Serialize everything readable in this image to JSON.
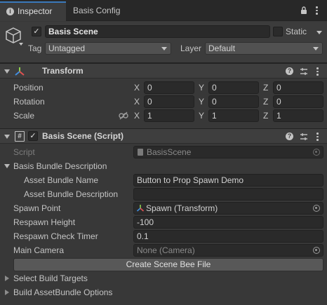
{
  "tabs": [
    {
      "label": "Inspector",
      "active": true,
      "icon": "info-icon"
    },
    {
      "label": "Basis Config",
      "active": false
    }
  ],
  "gameobject": {
    "active": true,
    "name": "Basis Scene",
    "static_label": "Static",
    "tag_label": "Tag",
    "tag_value": "Untagged",
    "layer_label": "Layer",
    "layer_value": "Default"
  },
  "transform": {
    "title": "Transform",
    "position": {
      "label": "Position",
      "x": "0",
      "y": "0",
      "z": "0"
    },
    "rotation": {
      "label": "Rotation",
      "x": "0",
      "y": "0",
      "z": "0"
    },
    "scale": {
      "label": "Scale",
      "x": "1",
      "y": "1",
      "z": "1"
    },
    "axis": {
      "x": "X",
      "y": "Y",
      "z": "Z"
    }
  },
  "script_component": {
    "title": "Basis Scene (Script)",
    "enabled": true,
    "script_label": "Script",
    "script_value": "BasisScene",
    "bundle_desc_label": "Basis Bundle Description",
    "asset_bundle_name_label": "Asset Bundle Name",
    "asset_bundle_name_value": "Button to Prop Spawn Demo",
    "asset_bundle_desc_label": "Asset Bundle Description",
    "asset_bundle_desc_value": "",
    "spawn_point_label": "Spawn Point",
    "spawn_point_value": "Spawn (Transform)",
    "respawn_height_label": "Respawn Height",
    "respawn_height_value": "-100",
    "respawn_timer_label": "Respawn Check Timer",
    "respawn_timer_value": "0.1",
    "main_camera_label": "Main Camera",
    "main_camera_value": "None (Camera)",
    "create_button_label": "Create Scene Bee File",
    "select_targets_label": "Select Build Targets",
    "build_options_label": "Build AssetBundle Options"
  },
  "colors": {
    "accent_tab": "#3c3c3c",
    "panel_bg": "#383838",
    "field_bg": "#2a2a2a"
  }
}
